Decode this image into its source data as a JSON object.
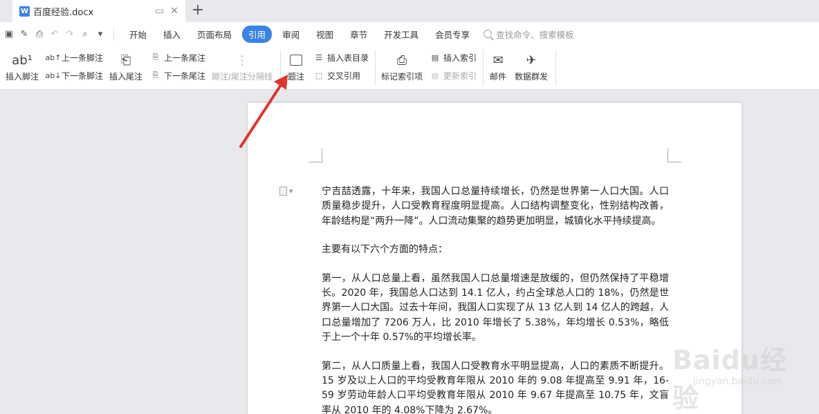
{
  "tab": {
    "title": "百度经验.docx",
    "logo": "W"
  },
  "menu": {
    "items": [
      "开始",
      "插入",
      "页面布局",
      "引用",
      "审阅",
      "视图",
      "章节",
      "开发工具",
      "会员专享"
    ],
    "active_index": 3,
    "search_placeholder": "查找命令、搜索模板"
  },
  "ribbon": {
    "insert_footnote": "插入脚注",
    "prev_footnote": "上一条脚注",
    "next_footnote": "下一条脚注",
    "insert_endnote": "插入尾注",
    "prev_endnote": "上一条尾注",
    "next_endnote": "下一条尾注",
    "separator_line": "脚注/尾注分隔线",
    "caption": "题注",
    "insert_toc": "插入表目录",
    "cross_ref": "交叉引用",
    "mark_index": "标记索引项",
    "insert_index": "插入索引",
    "update_index": "更新索引",
    "mail": "邮件",
    "mail_merge": "数据群发",
    "footnote_glyph": "ab¹"
  },
  "document": {
    "paragraphs": [
      "宁吉喆透露，十年来，我国人口总量持续增长，仍然是世界第一人口大国。人口质量稳步提升，人口受教育程度明显提高。人口结构调整变化，性别结构改善，年龄结构是“两升一降”。人口流动集聚的趋势更加明显，城镇化水平持续提高。",
      "主要有以下六个方面的特点：",
      "第一，从人口总量上看，虽然我国人口总量增速是放缓的，但仍然保持了平稳增长。2020 年，我国总人口达到 14.1 亿人，约占全球总人口的 18%，仍然是世界第一人口大国。过去十年间，我国人口实现了从 13 亿人到 14 亿人的跨越，人口总量增加了 7206 万人，比 2010 年增长了 5.38%，年均增长 0.53%，略低于上一个十年 0.57%的平均增长率。",
      "第二，从人口质量上看，我国人口受教育水平明显提高，人口的素质不断提升。15 岁及以上人口的平均受教育年限从 2010 年的 9.08 年提高至 9.91 年，16-59 岁劳动年龄人口平均受教育年限从 2010 年 9.67 年提高至 10.75 年，文盲率从 2010 年的 4.08%下降为 2.67%。"
    ]
  },
  "watermark": {
    "brand": "Baidu经验",
    "url": "jingyan.baidu.com"
  },
  "colors": {
    "accent": "#3b82e6",
    "arrow": "#e5322d"
  }
}
